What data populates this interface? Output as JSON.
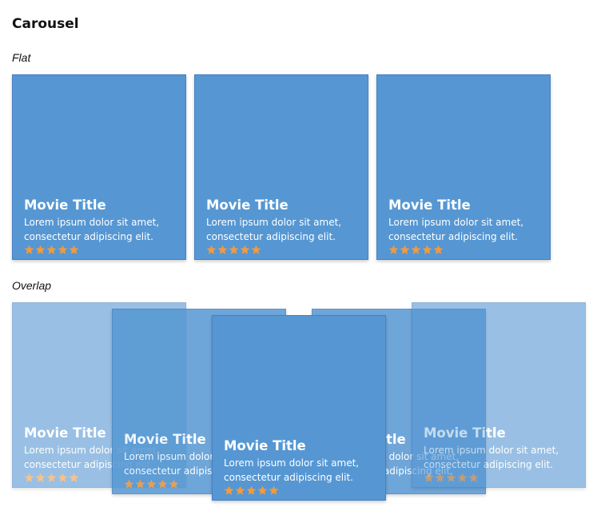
{
  "page": {
    "title": "Carousel"
  },
  "colors": {
    "card": "#5697d3",
    "star": "#f39a3c",
    "text": "#ffffff"
  },
  "sections": {
    "flat": {
      "label": "Flat",
      "cards": [
        {
          "title": "Movie Title",
          "description": "Lorem ipsum dolor sit amet, consectetur adipiscing elit.",
          "rating": 5
        },
        {
          "title": "Movie Title",
          "description": "Lorem ipsum dolor sit amet, consectetur adipiscing elit.",
          "rating": 5
        },
        {
          "title": "Movie Title",
          "description": "Lorem ipsum dolor sit amet, consectetur adipiscing elit.",
          "rating": 5
        }
      ]
    },
    "overlap": {
      "label": "Overlap",
      "cards": [
        {
          "title": "Movie Title",
          "description": "Lorem ipsum dolor sit amet, consectetur adipiscing elit.",
          "rating": 5,
          "opacity": 0.6
        },
        {
          "title": "Movie Title",
          "description": "Lorem ipsum dolor sit amet, consectetur adipiscing elit.",
          "rating": 5,
          "opacity": 0.85
        },
        {
          "title": "Movie Title",
          "description": "Lorem ipsum dolor sit amet, consectetur adipiscing elit.",
          "rating": 5,
          "opacity": 1
        },
        {
          "title": "Movie Title",
          "description": "Lorem ipsum dolor sit amet, consectetur adipiscing elit.",
          "rating": 5,
          "opacity": 0.85
        },
        {
          "title": "Movie Title",
          "description": "Lorem ipsum dolor sit amet, consectetur adipiscing elit.",
          "rating": 5,
          "opacity": 0.6
        }
      ]
    }
  }
}
